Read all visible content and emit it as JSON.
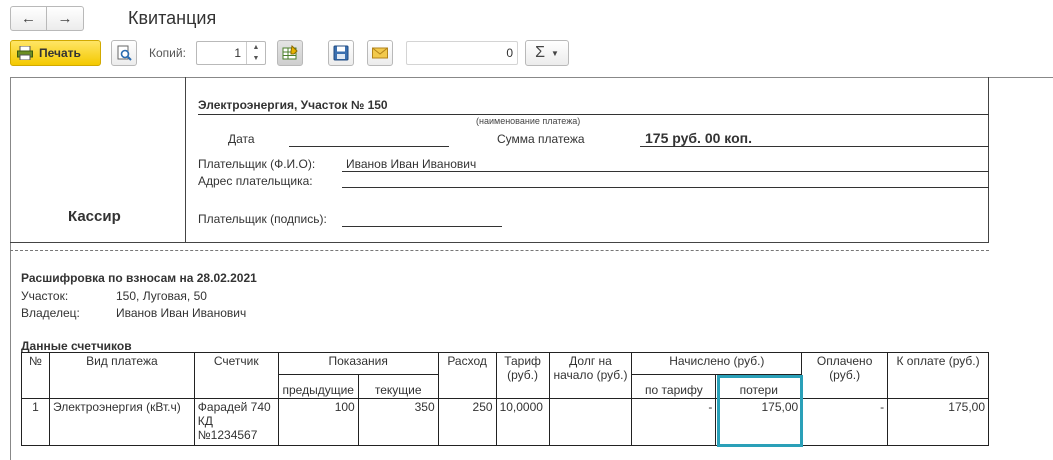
{
  "window": {
    "title": "Квитанция"
  },
  "nav": {
    "back_icon": "←",
    "forward_icon": "→"
  },
  "toolbar": {
    "print_label": "Печать",
    "copies_label": "Копий:",
    "copies_value": "1",
    "spin_up": "▲",
    "spin_down": "▼",
    "sum_value": "0",
    "sigma_label": "Σ",
    "caret": "▼"
  },
  "receipt": {
    "cashier_label": "Кассир",
    "payment_name": "Электроэнергия, Участок № 150",
    "payment_caption": "(наименование платежа)",
    "date_label": "Дата",
    "sum_label": "Сумма платежа",
    "sum_value": "175 руб. 00 коп.",
    "payer_label": "Плательщик (Ф.И.О):",
    "payer_value": "Иванов Иван Иванович",
    "address_label": "Адрес плательщика:",
    "signature_label": "Плательщик (подпись):"
  },
  "breakdown": {
    "title": "Расшифровка по взносам на 28.02.2021",
    "plot_label": "Участок:",
    "plot_value": "150, Луговая, 50",
    "owner_label": "Владелец:",
    "owner_value": "Иванов Иван Иванович",
    "meters_title": "Данные счетчиков"
  },
  "table": {
    "headers": {
      "num": "№",
      "payment_type": "Вид платежа",
      "meter": "Счетчик",
      "readings": "Показания",
      "prev": "предыдущие",
      "curr": "текущие",
      "usage": "Расход",
      "tariff": "Тариф (руб.)",
      "debt": "Долг на начало (руб.)",
      "accrued": "Начислено (руб.)",
      "by_tariff": "по тарифу",
      "losses": "потери",
      "paid": "Оплачено (руб.)",
      "to_pay": "К оплате (руб.)"
    },
    "rows": [
      {
        "num": "1",
        "payment_type": "Электроэнергия (кВт.ч)",
        "meter": "Фарадей 740 КД №1234567",
        "prev": "100",
        "curr": "350",
        "usage": "250",
        "tariff": "10,0000",
        "debt": "",
        "by_tariff": "-",
        "losses": "175,00",
        "paid": "-",
        "to_pay": "175,00"
      }
    ]
  },
  "colors": {
    "print_button": "#f4c900",
    "highlight": "#2aa0b8"
  }
}
